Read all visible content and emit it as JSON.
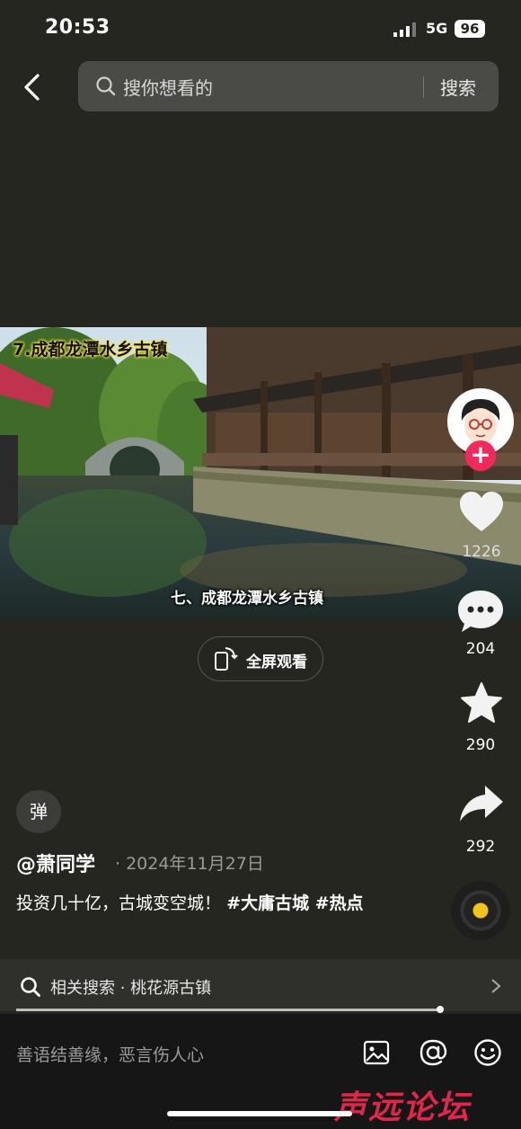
{
  "status_bar": {
    "time": "20:53",
    "network": "5G",
    "battery": "96"
  },
  "search": {
    "placeholder": "搜你想看的",
    "button": "搜索"
  },
  "video": {
    "title_overlay": "7.成都龙潭水乡古镇",
    "caption_overlay": "七、成都龙潭水乡古镇",
    "fullscreen_label": "全屏观看"
  },
  "actions": {
    "likes": "1226",
    "comments": "204",
    "favorites": "290",
    "shares": "292",
    "follow_symbol": "+"
  },
  "danmu": {
    "label": "弹"
  },
  "post": {
    "author": "@萧同学",
    "date": "· 2024年11月27日",
    "text": "投资几十亿，古城变空城！",
    "tags": "#大庸古城 #热点"
  },
  "related": {
    "label": "相关搜索 · 桃花源古镇"
  },
  "progress": {
    "fraction": 0.96
  },
  "comment_bar": {
    "placeholder": "善语结善缘，恶言伤人心"
  },
  "watermark": "声远论坛",
  "colors": {
    "background": "#262621",
    "accent": "#f2295b",
    "disc": "#f3c31c"
  }
}
